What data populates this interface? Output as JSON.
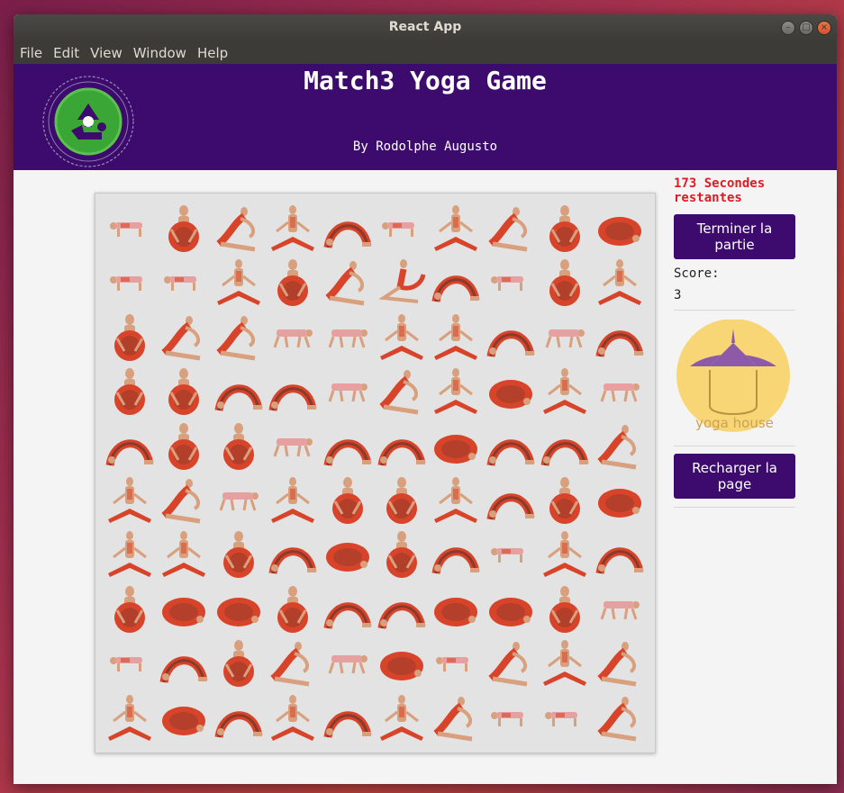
{
  "window": {
    "title": "React App"
  },
  "menu": [
    "File",
    "Edit",
    "View",
    "Window",
    "Help"
  ],
  "header": {
    "title": "Match3 Yoga Game",
    "subtitle": "By Rodolphe Augusto"
  },
  "sidebar": {
    "timer": "173 Secondes restantes",
    "end_button": "Terminer la partie",
    "score_label": "Score:",
    "score_value": "3",
    "brand_text": "yoga house",
    "reload_button": "Recharger la page"
  },
  "tile_types": {
    "A": "plank-pose",
    "B": "seated-wide-pose",
    "C": "bound-seated-pose",
    "D": "bridge-pose",
    "E": "pigeon-pose",
    "F": "crawl-pose",
    "G": "folded-pose",
    "H": "mermaid-pose"
  },
  "board": [
    [
      "A",
      "C",
      "E",
      "B",
      "D",
      "A",
      "B",
      "E",
      "C",
      "G"
    ],
    [
      "A",
      "A",
      "B",
      "C",
      "E",
      "H",
      "D",
      "A",
      "C",
      "B"
    ],
    [
      "C",
      "E",
      "E",
      "F",
      "F",
      "B",
      "B",
      "D",
      "F",
      "D"
    ],
    [
      "C",
      "C",
      "D",
      "D",
      "F",
      "E",
      "B",
      "G",
      "B",
      "F"
    ],
    [
      "D",
      "C",
      "C",
      "F",
      "D",
      "D",
      "G",
      "D",
      "D",
      "E"
    ],
    [
      "B",
      "E",
      "F",
      "B",
      "C",
      "C",
      "B",
      "D",
      "C",
      "G"
    ],
    [
      "B",
      "B",
      "C",
      "D",
      "G",
      "C",
      "D",
      "A",
      "B",
      "D"
    ],
    [
      "C",
      "G",
      "G",
      "C",
      "D",
      "D",
      "G",
      "G",
      "C",
      "F"
    ],
    [
      "A",
      "D",
      "C",
      "E",
      "F",
      "G",
      "A",
      "E",
      "B",
      "E"
    ],
    [
      "B",
      "G",
      "D",
      "B",
      "D",
      "B",
      "E",
      "A",
      "A",
      "E"
    ]
  ],
  "colors": {
    "header_bg": "#3d0a6e",
    "button_bg": "#3d0a6e",
    "timer": "#e01b24"
  }
}
